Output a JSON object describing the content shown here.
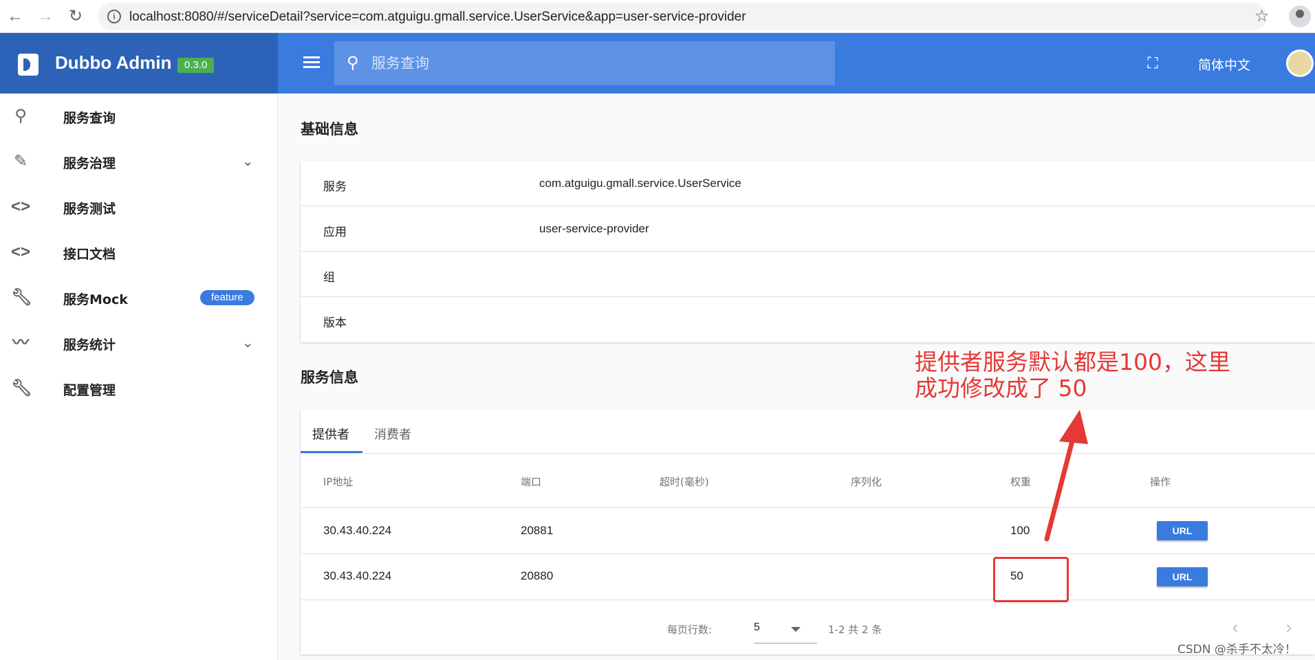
{
  "browser": {
    "url": "localhost:8080/#/serviceDetail?service=com.atguigu.gmall.service.UserService&app=user-service-provider"
  },
  "app": {
    "title": "Dubbo Admin",
    "version": "0.3.0",
    "search_placeholder": "服务查询",
    "language": "简体中文"
  },
  "sidebar": {
    "items": [
      {
        "label": "服务查询",
        "icon": "search-icon"
      },
      {
        "label": "服务治理",
        "icon": "pencil-icon",
        "expandable": true
      },
      {
        "label": "服务测试",
        "icon": "code-icon"
      },
      {
        "label": "接口文档",
        "icon": "code-icon"
      },
      {
        "label": "服务Mock",
        "icon": "wrench-icon",
        "badge": "feature"
      },
      {
        "label": "服务统计",
        "icon": "trending-icon",
        "expandable": true
      },
      {
        "label": "配置管理",
        "icon": "wrench-icon"
      }
    ]
  },
  "basic_info": {
    "title": "基础信息",
    "rows": [
      {
        "key": "服务",
        "value": "com.atguigu.gmall.service.UserService"
      },
      {
        "key": "应用",
        "value": "user-service-provider"
      },
      {
        "key": "组",
        "value": ""
      },
      {
        "key": "版本",
        "value": ""
      }
    ]
  },
  "service_info": {
    "title": "服务信息",
    "tabs": [
      {
        "label": "提供者",
        "active": true
      },
      {
        "label": "消费者",
        "active": false
      }
    ],
    "columns": [
      "IP地址",
      "端口",
      "超时(毫秒)",
      "序列化",
      "权重",
      "操作"
    ],
    "rows": [
      {
        "ip": "30.43.40.224",
        "port": "20881",
        "timeout": "",
        "serialization": "",
        "weight": "100",
        "action": "URL"
      },
      {
        "ip": "30.43.40.224",
        "port": "20880",
        "timeout": "",
        "serialization": "",
        "weight": "50",
        "action": "URL"
      }
    ],
    "pagination": {
      "rows_per_page_label": "每页行数:",
      "rows_per_page": "5",
      "range": "1-2 共 2 条"
    }
  },
  "annotation": {
    "line1": "提供者服务默认都是100，这里",
    "line2": "成功修改成了 50",
    "color": "#e53935"
  },
  "watermark": "CSDN @杀手不太冷！",
  "colors": {
    "primary": "#3a7be0",
    "logo_bar": "#2c63b8",
    "version_badge": "#4caf50"
  }
}
